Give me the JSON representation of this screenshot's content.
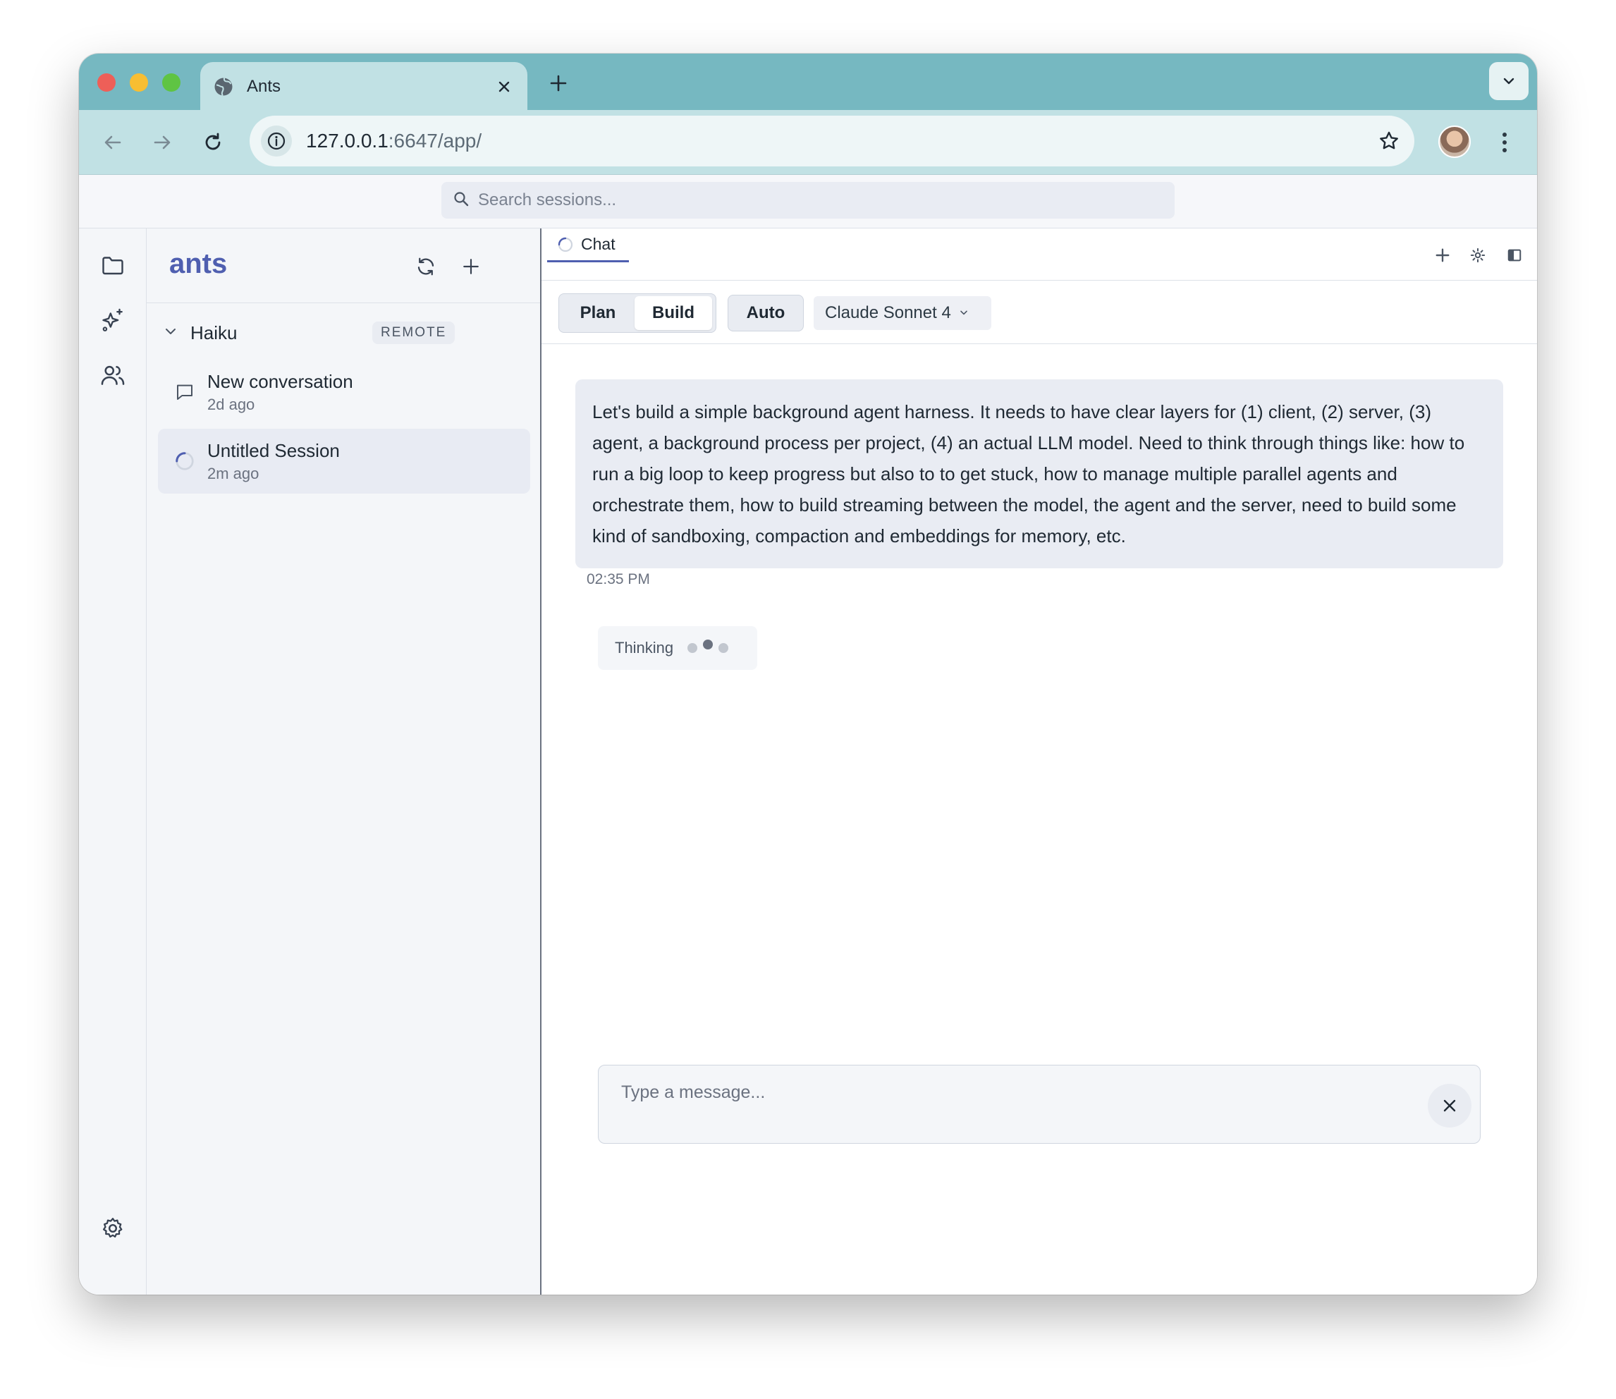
{
  "browser": {
    "tab_title": "Ants",
    "url_host": "127.0.0.1",
    "url_path": ":6647/app/"
  },
  "search": {
    "placeholder": "Search sessions..."
  },
  "sidebar": {
    "brand": "ants",
    "group": {
      "name": "Haiku",
      "badge": "REMOTE"
    },
    "sessions": [
      {
        "title": "New conversation",
        "time": "2d ago",
        "icon": "chat-bubble-icon",
        "active": false
      },
      {
        "title": "Untitled Session",
        "time": "2m ago",
        "icon": "spinner-icon",
        "active": true
      }
    ]
  },
  "main": {
    "tab_label": "Chat",
    "modes": {
      "plan": "Plan",
      "build": "Build",
      "selected": "Build",
      "auto": "Auto"
    },
    "model": "Claude Sonnet 4",
    "message": {
      "text": "Let's build a simple background agent harness. It needs to have clear layers for (1) client, (2) server, (3) agent, a background process per project, (4) an actual LLM model. Need to think through things like: how to run a big loop to keep progress but also to to get stuck, how to manage multiple parallel agents and orchestrate them, how to build streaming between the model, the agent and the server, need to build some kind of sandboxing, compaction and embeddings for memory, etc.",
      "time": "02:35 PM"
    },
    "thinking_label": "Thinking",
    "composer": {
      "placeholder": "Type a message..."
    }
  },
  "colors": {
    "accent": "#4f5fb0",
    "tabbar": "#76b8c1",
    "toolbar": "#c1e1e4"
  }
}
